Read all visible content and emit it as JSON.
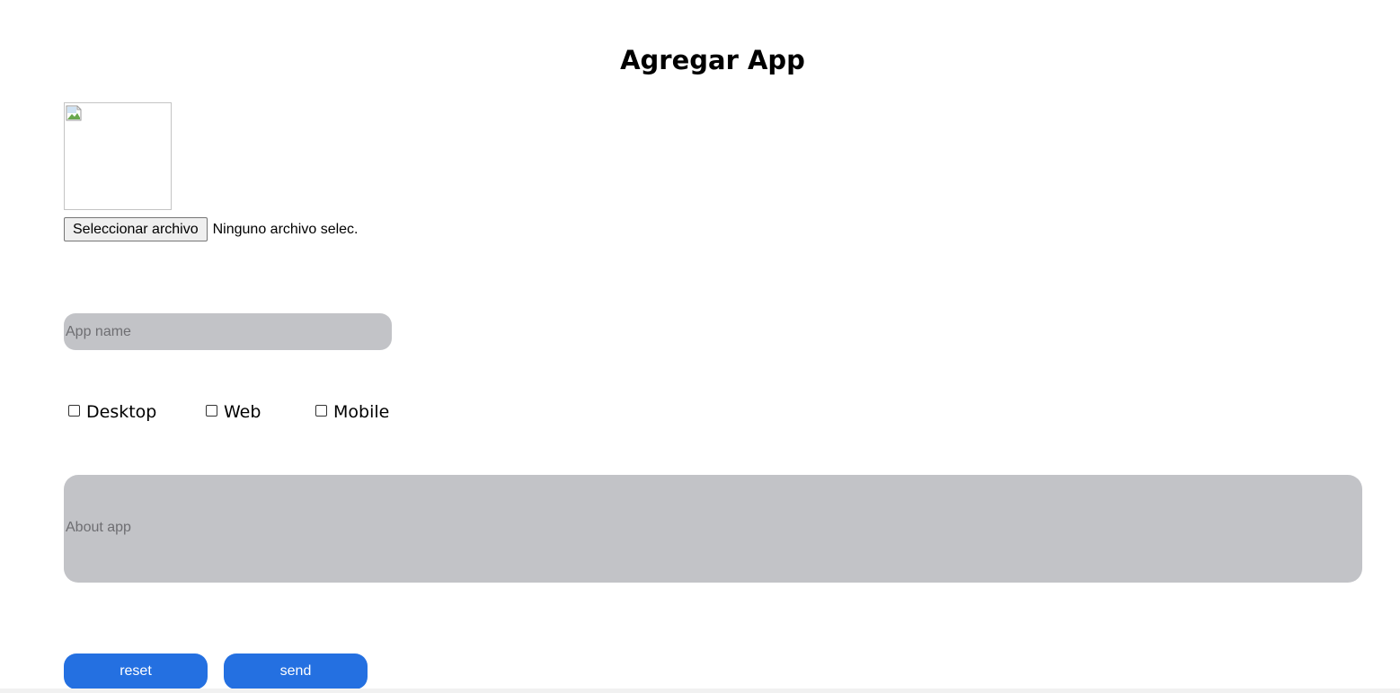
{
  "form": {
    "title": "Agregar App",
    "file_picker": {
      "button_label": "Seleccionar archivo",
      "status_text": "Ninguno archivo selec."
    },
    "app_name": {
      "placeholder": "App name",
      "value": ""
    },
    "platforms": [
      {
        "label": "Desktop",
        "checked": false
      },
      {
        "label": "Web",
        "checked": false
      },
      {
        "label": "Mobile",
        "checked": false
      }
    ],
    "about": {
      "placeholder": "About app"
    },
    "buttons": {
      "reset_label": "reset",
      "send_label": "send"
    }
  },
  "colors": {
    "field_background": "#c2c3c7",
    "button_background": "#2470e1",
    "button_text": "#ffffff"
  },
  "icons": {
    "image_placeholder": "broken-image-icon"
  }
}
